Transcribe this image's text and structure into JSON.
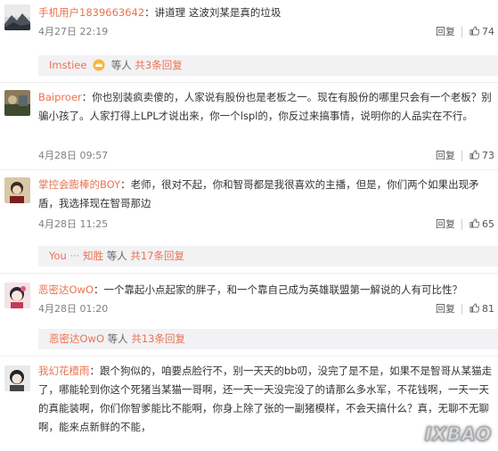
{
  "comments": [
    {
      "username": "手机用户1839663642",
      "text": "：讲道理 这波刘某是真的垃圾",
      "time": "4月27日 22:19",
      "reply_label": "回复",
      "likes": "74",
      "avatar_icon": "landscape-avatar-icon",
      "replies": {
        "user": "Imstiee",
        "suffix": "等人",
        "more": "共3条回复"
      }
    },
    {
      "username": "Baiproer",
      "text": "：你也别装疯卖傻的，人家说有股份也是老板之一。现在有股份的哪里只会有一个老板？别骗小孩了。人家打得上LPL才说出来，你一个lspl的，你反过来搞事情，说明你的人品实在不行。",
      "time": "4月28日 09:57",
      "reply_label": "回复",
      "likes": "73",
      "avatar_icon": "photo-avatar-icon"
    },
    {
      "username": "掌控会膨棒的BOY",
      "text": "：老师，很对不起，你和智哥都是我很喜欢的主播，但是，你们两个如果出现矛盾，我选择现在智哥那边",
      "time": "4月28日 11:25",
      "reply_label": "回复",
      "likes": "65",
      "avatar_icon": "character-avatar-icon",
      "replies": {
        "user": "You",
        "user2": "知胜",
        "suffix": "等人",
        "more": "共17条回复"
      }
    },
    {
      "username": "恶密达OwO",
      "text": "：一个靠起小点起家的胖子，和一个靠自己成为英雄联盟第一解说的人有可比性？",
      "time": "4月28日 01:20",
      "reply_label": "回复",
      "likes": "81",
      "avatar_icon": "anime-avatar-icon",
      "replies": {
        "user": "恶密达OwO",
        "suffix": "等人",
        "more": "共13条回复"
      }
    },
    {
      "username": "我幻花檀雨",
      "text": "：跟个狗似的，咱要点脸行不，别一天天的bb叨，没完了是不是，如果不是智哥从某猫走了，哪能轮到你这个死猪当某猫一哥啊，还一天一天没完没了的请那么多水军，不花钱啊，一天一天的真能装啊，你们你智爹能比不能啊，你身上除了张的一副猪模样，不会天搞什么？真，无聊不无聊啊，能来点新鲜的不能，",
      "avatar_icon": "girl-avatar-icon"
    }
  ],
  "watermark": "IXBAO",
  "colors": {
    "accent": "#eb7350",
    "subbox_bg": "#f2f2f5"
  }
}
